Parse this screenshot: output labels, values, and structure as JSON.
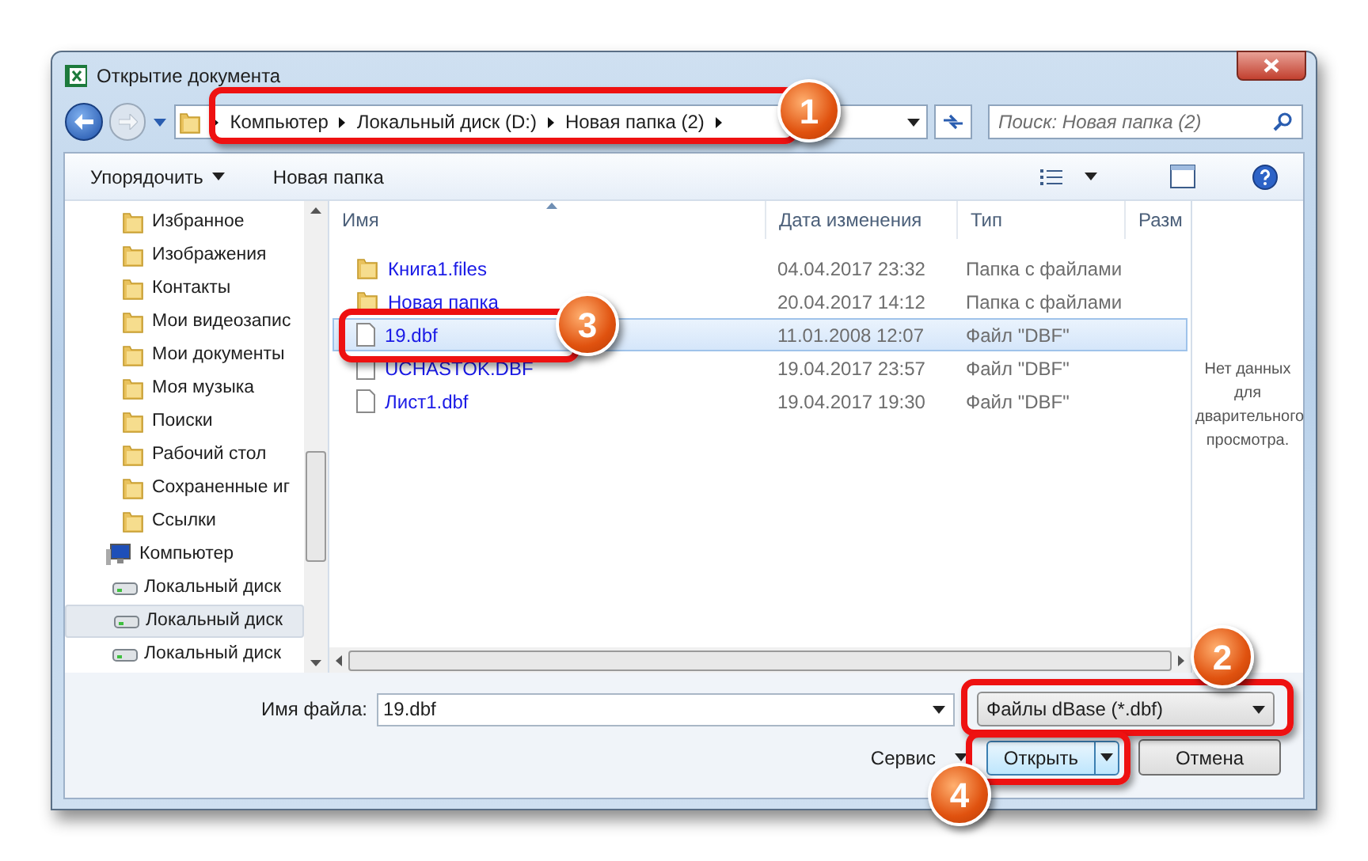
{
  "window": {
    "title": "Открытие документа"
  },
  "address_bar": {
    "crumbs": [
      "Компьютер",
      "Локальный диск (D:)",
      "Новая папка (2)"
    ]
  },
  "search": {
    "placeholder": "Поиск: Новая папка (2)"
  },
  "toolbar": {
    "organize": "Упорядочить",
    "new_folder": "Новая папка"
  },
  "sidebar": {
    "folders": [
      {
        "label": "Избранное"
      },
      {
        "label": "Изображения"
      },
      {
        "label": "Контакты"
      },
      {
        "label": "Мои видеозапис"
      },
      {
        "label": "Мои документы"
      },
      {
        "label": "Моя музыка"
      },
      {
        "label": "Поиски"
      },
      {
        "label": "Рабочий стол"
      },
      {
        "label": "Сохраненные иг"
      },
      {
        "label": "Ссылки"
      }
    ],
    "computer": {
      "label": "Компьютер",
      "children": [
        {
          "label": "Локальный диск",
          "selected": false
        },
        {
          "label": "Локальный диск",
          "selected": true
        },
        {
          "label": "Локальный диск",
          "selected": false
        }
      ]
    }
  },
  "table": {
    "columns": [
      "Имя",
      "Дата изменения",
      "Тип",
      "Разм"
    ],
    "rows": [
      {
        "kind": "folder",
        "name": "Книга1.files",
        "date": "04.04.2017 23:32",
        "type": "Папка с файлами",
        "selected": false
      },
      {
        "kind": "folder",
        "name": "Новая папка",
        "date": "20.04.2017 14:12",
        "type": "Папка с файлами",
        "selected": false
      },
      {
        "kind": "file",
        "name": "19.dbf",
        "date": "11.01.2008 12:07",
        "type": "Файл \"DBF\"",
        "selected": true
      },
      {
        "kind": "file",
        "name": "UCHASTOK.DBF",
        "date": "19.04.2017 23:57",
        "type": "Файл \"DBF\"",
        "selected": false
      },
      {
        "kind": "file",
        "name": "Лист1.dbf",
        "date": "19.04.2017 19:30",
        "type": "Файл \"DBF\"",
        "selected": false
      }
    ]
  },
  "preview": {
    "message": "Нет данных для дварительного просмотра."
  },
  "file_name": {
    "label": "Имя файла:",
    "value": "19.dbf"
  },
  "file_type": {
    "value": "Файлы dBase (*.dbf)"
  },
  "buttons": {
    "tools": "Сервис",
    "open": "Открыть",
    "cancel": "Отмена"
  },
  "annotations": [
    {
      "number": "1"
    },
    {
      "number": "2"
    },
    {
      "number": "3"
    },
    {
      "number": "4"
    }
  ]
}
